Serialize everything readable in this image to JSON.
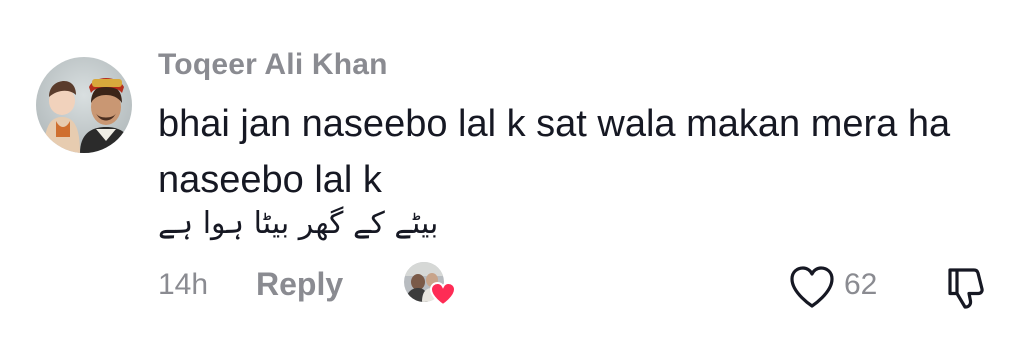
{
  "comment": {
    "username": "Toqeer Ali Khan",
    "text": "bhai jan naseebo lal k sat wala makan mera ha\nnaseebo lal k",
    "urdu_text": "بیٹے کے گھر بیٹا ہوا ہے",
    "timestamp": "14h",
    "reply_label": "Reply",
    "like_count": "62",
    "avatar_icon": "user-avatar",
    "creator_liked_icon": "creator-liked-heart-icon",
    "like_icon": "heart-outline-icon",
    "dislike_icon": "thumbs-down-icon",
    "heart_color": "#fe2c55",
    "muted_text_color": "#8a8b91",
    "text_color": "#161823"
  }
}
